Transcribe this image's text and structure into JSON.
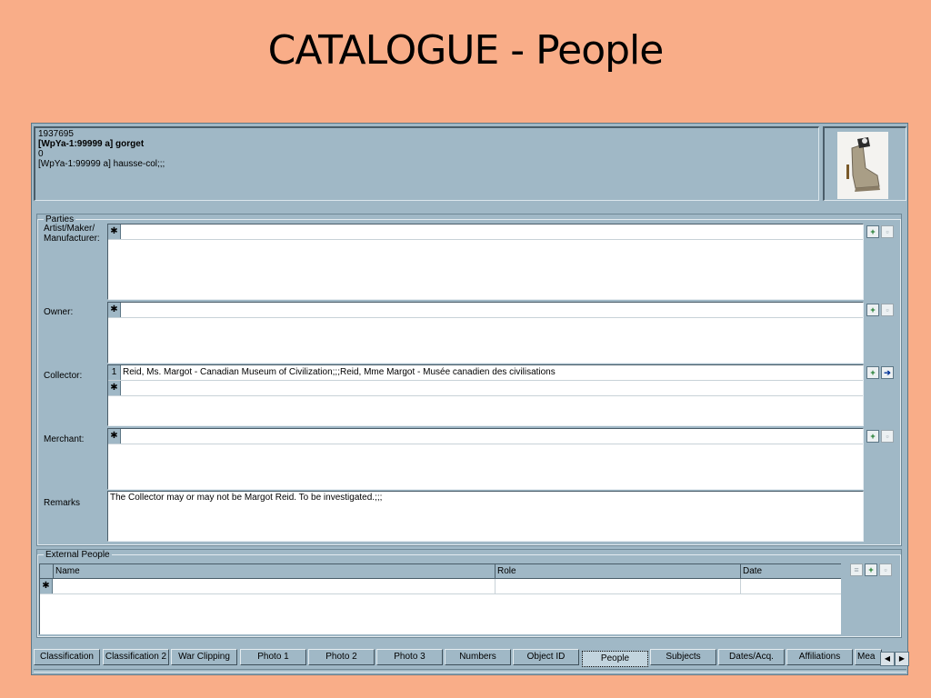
{
  "slide": {
    "title": "CATALOGUE - People"
  },
  "record": {
    "id": "1937695",
    "name_en": "[WpYa-1:99999 a] gorget",
    "zero": "0",
    "name_fr": "[WpYa-1:99999 a] hausse-col;;;"
  },
  "parties": {
    "legend": "Parties",
    "artist_label": "Artist/Maker/ Manufacturer:",
    "owner_label": "Owner:",
    "collector_label": "Collector:",
    "merchant_label": "Merchant:",
    "remarks_label": "Remarks",
    "new_row_marker": "✱",
    "collector_rows": [
      {
        "marker": "1",
        "value": "Reid, Ms. Margot - Canadian Museum of Civilization;;;Reid, Mme Margot - Musée canadien des civilisations"
      }
    ],
    "remarks_value": "The Collector may or may not be Margot Reid. To be investigated.;;;"
  },
  "external": {
    "legend": "External People",
    "columns": [
      "Name",
      "Role",
      "Date"
    ]
  },
  "tabs": [
    {
      "label": "Classification",
      "active": false
    },
    {
      "label": "Classification 2",
      "active": false
    },
    {
      "label": "War Clipping",
      "active": false
    },
    {
      "label": "Photo 1",
      "active": false
    },
    {
      "label": "Photo 2",
      "active": false
    },
    {
      "label": "Photo 3",
      "active": false
    },
    {
      "label": "Numbers",
      "active": false
    },
    {
      "label": "Object ID",
      "active": false
    },
    {
      "label": "People",
      "active": true
    },
    {
      "label": "Subjects",
      "active": false
    },
    {
      "label": "Dates/Acq.",
      "active": false
    },
    {
      "label": "Affiliations",
      "active": false
    },
    {
      "label": "Mea",
      "active": false
    }
  ],
  "icons": {
    "add": "add-record-icon",
    "edit": "edit-record-icon",
    "goto": "goto-record-icon",
    "list": "list-icon",
    "scroll_left": "scroll-left-icon",
    "scroll_right": "scroll-right-icon"
  },
  "colors": {
    "slide_bg": "#f9ad88",
    "form_bg": "#a0b8c6",
    "active_tab": "#c2d4de"
  }
}
